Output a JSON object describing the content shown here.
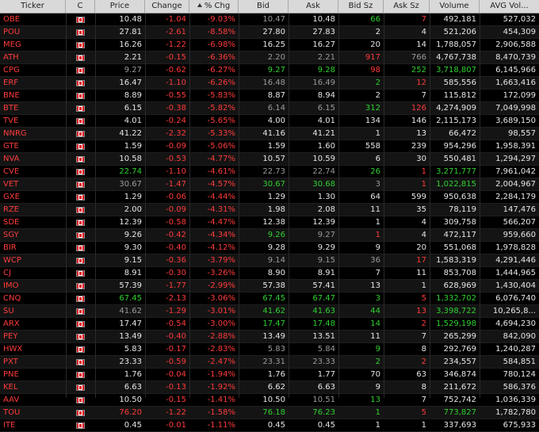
{
  "columns": [
    {
      "key": "ticker",
      "label": "Ticker"
    },
    {
      "key": "c",
      "label": "C"
    },
    {
      "key": "price",
      "label": "Price"
    },
    {
      "key": "change",
      "label": "Change"
    },
    {
      "key": "pct",
      "label": "% Chg"
    },
    {
      "key": "bid",
      "label": "Bid"
    },
    {
      "key": "ask",
      "label": "Ask"
    },
    {
      "key": "bidsz",
      "label": "Bid Sz"
    },
    {
      "key": "asksz",
      "label": "Ask Sz"
    },
    {
      "key": "volume",
      "label": "Volume"
    },
    {
      "key": "avgvol",
      "label": "AVG Vol..."
    }
  ],
  "colors": {
    "red": "#ff3b3b",
    "green": "#2fd12f",
    "grey": "#9a9a9a",
    "white": "#dcdcdc"
  },
  "rows": [
    {
      "ticker": "OBE",
      "price": "10.48",
      "change": "-1.04",
      "pct": "-9.03%",
      "bid": "10.47",
      "ask": "10.48",
      "bidsz": "66",
      "asksz": "7",
      "volume": "492,181",
      "avgvol": "527,032",
      "pc": "white",
      "bc": "grey",
      "ac": "white",
      "bsc": "green",
      "asc": "red",
      "vc": "white"
    },
    {
      "ticker": "POU",
      "price": "27.81",
      "change": "-2.61",
      "pct": "-8.58%",
      "bid": "27.80",
      "ask": "27.83",
      "bidsz": "2",
      "asksz": "4",
      "volume": "521,206",
      "avgvol": "454,309",
      "pc": "white",
      "bc": "white",
      "ac": "white",
      "bsc": "white",
      "asc": "white",
      "vc": "white"
    },
    {
      "ticker": "MEG",
      "price": "16.26",
      "change": "-1.22",
      "pct": "-6.98%",
      "bid": "16.25",
      "ask": "16.27",
      "bidsz": "20",
      "asksz": "14",
      "volume": "1,788,057",
      "avgvol": "2,906,588",
      "pc": "white",
      "bc": "white",
      "ac": "white",
      "bsc": "white",
      "asc": "white",
      "vc": "white"
    },
    {
      "ticker": "ATH",
      "price": "2.21",
      "change": "-0.15",
      "pct": "-6.36%",
      "bid": "2.20",
      "ask": "2.21",
      "bidsz": "917",
      "asksz": "766",
      "volume": "4,767,738",
      "avgvol": "8,470,739",
      "pc": "white",
      "bc": "grey",
      "ac": "grey",
      "bsc": "red",
      "asc": "grey",
      "vc": "white"
    },
    {
      "ticker": "CPG",
      "price": "9.27",
      "change": "-0.62",
      "pct": "-6.27%",
      "bid": "9.27",
      "ask": "9.28",
      "bidsz": "98",
      "asksz": "252",
      "volume": "3,718,807",
      "avgvol": "6,145,966",
      "pc": "grey",
      "bc": "green",
      "ac": "green",
      "bsc": "red",
      "asc": "green",
      "vc": "green"
    },
    {
      "ticker": "ERF",
      "price": "16.47",
      "change": "-1.10",
      "pct": "-6.26%",
      "bid": "16.48",
      "ask": "16.49",
      "bidsz": "2",
      "asksz": "12",
      "volume": "585,556",
      "avgvol": "1,663,416",
      "pc": "white",
      "bc": "grey",
      "ac": "grey",
      "bsc": "green",
      "asc": "red",
      "vc": "white"
    },
    {
      "ticker": "BNE",
      "price": "8.89",
      "change": "-0.55",
      "pct": "-5.83%",
      "bid": "8.87",
      "ask": "8.94",
      "bidsz": "2",
      "asksz": "7",
      "volume": "115,812",
      "avgvol": "172,099",
      "pc": "white",
      "bc": "white",
      "ac": "white",
      "bsc": "white",
      "asc": "white",
      "vc": "white"
    },
    {
      "ticker": "BTE",
      "price": "6.15",
      "change": "-0.38",
      "pct": "-5.82%",
      "bid": "6.14",
      "ask": "6.15",
      "bidsz": "312",
      "asksz": "126",
      "volume": "4,274,909",
      "avgvol": "7,049,998",
      "pc": "white",
      "bc": "grey",
      "ac": "grey",
      "bsc": "green",
      "asc": "red",
      "vc": "white"
    },
    {
      "ticker": "TVE",
      "price": "4.01",
      "change": "-0.24",
      "pct": "-5.65%",
      "bid": "4.00",
      "ask": "4.01",
      "bidsz": "134",
      "asksz": "146",
      "volume": "2,115,173",
      "avgvol": "3,689,150",
      "pc": "white",
      "bc": "white",
      "ac": "white",
      "bsc": "white",
      "asc": "white",
      "vc": "white"
    },
    {
      "ticker": "NNRG",
      "price": "41.22",
      "change": "-2.32",
      "pct": "-5.33%",
      "bid": "41.16",
      "ask": "41.21",
      "bidsz": "1",
      "asksz": "13",
      "volume": "66,472",
      "avgvol": "98,557",
      "pc": "white",
      "bc": "white",
      "ac": "white",
      "bsc": "white",
      "asc": "white",
      "vc": "white"
    },
    {
      "ticker": "GTE",
      "price": "1.59",
      "change": "-0.09",
      "pct": "-5.06%",
      "bid": "1.59",
      "ask": "1.60",
      "bidsz": "558",
      "asksz": "239",
      "volume": "954,296",
      "avgvol": "1,958,391",
      "pc": "white",
      "bc": "white",
      "ac": "white",
      "bsc": "white",
      "asc": "white",
      "vc": "white"
    },
    {
      "ticker": "NVA",
      "price": "10.58",
      "change": "-0.53",
      "pct": "-4.77%",
      "bid": "10.57",
      "ask": "10.59",
      "bidsz": "6",
      "asksz": "30",
      "volume": "550,481",
      "avgvol": "1,294,297",
      "pc": "white",
      "bc": "white",
      "ac": "white",
      "bsc": "white",
      "asc": "white",
      "vc": "white"
    },
    {
      "ticker": "CVE",
      "price": "22.74",
      "change": "-1.10",
      "pct": "-4.61%",
      "bid": "22.73",
      "ask": "22.74",
      "bidsz": "26",
      "asksz": "1",
      "volume": "3,271,777",
      "avgvol": "7,961,042",
      "pc": "green",
      "bc": "grey",
      "ac": "grey",
      "bsc": "green",
      "asc": "red",
      "vc": "green"
    },
    {
      "ticker": "VET",
      "price": "30.67",
      "change": "-1.47",
      "pct": "-4.57%",
      "bid": "30.67",
      "ask": "30.68",
      "bidsz": "3",
      "asksz": "1",
      "volume": "1,022,815",
      "avgvol": "2,004,967",
      "pc": "grey",
      "bc": "green",
      "ac": "green",
      "bsc": "grey",
      "asc": "red",
      "vc": "green"
    },
    {
      "ticker": "GXE",
      "price": "1.29",
      "change": "-0.06",
      "pct": "-4.44%",
      "bid": "1.29",
      "ask": "1.30",
      "bidsz": "64",
      "asksz": "599",
      "volume": "950,638",
      "avgvol": "2,284,179",
      "pc": "white",
      "bc": "white",
      "ac": "white",
      "bsc": "white",
      "asc": "white",
      "vc": "white"
    },
    {
      "ticker": "RZE",
      "price": "2.00",
      "change": "-0.09",
      "pct": "-4.31%",
      "bid": "1.98",
      "ask": "2.08",
      "bidsz": "11",
      "asksz": "35",
      "volume": "78,119",
      "avgvol": "147,476",
      "pc": "white",
      "bc": "white",
      "ac": "white",
      "bsc": "white",
      "asc": "white",
      "vc": "white"
    },
    {
      "ticker": "SDE",
      "price": "12.39",
      "change": "-0.58",
      "pct": "-4.47%",
      "bid": "12.38",
      "ask": "12.39",
      "bidsz": "1",
      "asksz": "4",
      "volume": "309,758",
      "avgvol": "566,207",
      "pc": "white",
      "bc": "white",
      "ac": "white",
      "bsc": "white",
      "asc": "white",
      "vc": "white"
    },
    {
      "ticker": "SGY",
      "price": "9.26",
      "change": "-0.42",
      "pct": "-4.34%",
      "bid": "9.26",
      "ask": "9.27",
      "bidsz": "1",
      "asksz": "4",
      "volume": "472,117",
      "avgvol": "959,660",
      "pc": "white",
      "bc": "green",
      "ac": "grey",
      "bsc": "red",
      "asc": "white",
      "vc": "white"
    },
    {
      "ticker": "BIR",
      "price": "9.30",
      "change": "-0.40",
      "pct": "-4.12%",
      "bid": "9.28",
      "ask": "9.29",
      "bidsz": "9",
      "asksz": "20",
      "volume": "551,068",
      "avgvol": "1,978,828",
      "pc": "white",
      "bc": "white",
      "ac": "white",
      "bsc": "white",
      "asc": "white",
      "vc": "white"
    },
    {
      "ticker": "WCP",
      "price": "9.15",
      "change": "-0.36",
      "pct": "-3.79%",
      "bid": "9.14",
      "ask": "9.15",
      "bidsz": "36",
      "asksz": "17",
      "volume": "1,583,319",
      "avgvol": "4,291,446",
      "pc": "white",
      "bc": "grey",
      "ac": "grey",
      "bsc": "grey",
      "asc": "red",
      "vc": "white"
    },
    {
      "ticker": "CJ",
      "price": "8.91",
      "change": "-0.30",
      "pct": "-3.26%",
      "bid": "8.90",
      "ask": "8.91",
      "bidsz": "7",
      "asksz": "11",
      "volume": "853,708",
      "avgvol": "1,444,965",
      "pc": "white",
      "bc": "white",
      "ac": "white",
      "bsc": "white",
      "asc": "white",
      "vc": "white"
    },
    {
      "ticker": "IMO",
      "price": "57.39",
      "change": "-1.77",
      "pct": "-2.99%",
      "bid": "57.38",
      "ask": "57.41",
      "bidsz": "13",
      "asksz": "1",
      "volume": "628,969",
      "avgvol": "1,430,404",
      "pc": "white",
      "bc": "white",
      "ac": "white",
      "bsc": "white",
      "asc": "white",
      "vc": "white"
    },
    {
      "ticker": "CNQ",
      "price": "67.45",
      "change": "-2.13",
      "pct": "-3.06%",
      "bid": "67.45",
      "ask": "67.47",
      "bidsz": "3",
      "asksz": "5",
      "volume": "1,332,702",
      "avgvol": "6,076,740",
      "pc": "green",
      "bc": "green",
      "ac": "green",
      "bsc": "green",
      "asc": "red",
      "vc": "green"
    },
    {
      "ticker": "SU",
      "price": "41.62",
      "change": "-1.29",
      "pct": "-3.01%",
      "bid": "41.62",
      "ask": "41.63",
      "bidsz": "44",
      "asksz": "13",
      "volume": "3,398,722",
      "avgvol": "10,265,8...",
      "pc": "grey",
      "bc": "green",
      "ac": "green",
      "bsc": "green",
      "asc": "red",
      "vc": "green"
    },
    {
      "ticker": "ARX",
      "price": "17.47",
      "change": "-0.54",
      "pct": "-3.00%",
      "bid": "17.47",
      "ask": "17.48",
      "bidsz": "14",
      "asksz": "2",
      "volume": "1,529,198",
      "avgvol": "4,694,230",
      "pc": "white",
      "bc": "green",
      "ac": "green",
      "bsc": "green",
      "asc": "red",
      "vc": "green"
    },
    {
      "ticker": "PEY",
      "price": "13.49",
      "change": "-0.40",
      "pct": "-2.88%",
      "bid": "13.49",
      "ask": "13.51",
      "bidsz": "11",
      "asksz": "7",
      "volume": "265,299",
      "avgvol": "842,090",
      "pc": "white",
      "bc": "white",
      "ac": "white",
      "bsc": "white",
      "asc": "white",
      "vc": "white"
    },
    {
      "ticker": "HWX",
      "price": "5.83",
      "change": "-0.17",
      "pct": "-2.83%",
      "bid": "5.83",
      "ask": "5.84",
      "bidsz": "9",
      "asksz": "8",
      "volume": "292,769",
      "avgvol": "1,240,287",
      "pc": "white",
      "bc": "grey",
      "ac": "grey",
      "bsc": "green",
      "asc": "white",
      "vc": "white"
    },
    {
      "ticker": "PXT",
      "price": "23.33",
      "change": "-0.59",
      "pct": "-2.47%",
      "bid": "23.31",
      "ask": "23.33",
      "bidsz": "2",
      "asksz": "2",
      "volume": "234,557",
      "avgvol": "584,851",
      "pc": "white",
      "bc": "grey",
      "ac": "grey",
      "bsc": "green",
      "asc": "red",
      "vc": "white"
    },
    {
      "ticker": "PNE",
      "price": "1.76",
      "change": "-0.04",
      "pct": "-1.94%",
      "bid": "1.76",
      "ask": "1.77",
      "bidsz": "70",
      "asksz": "63",
      "volume": "346,874",
      "avgvol": "780,124",
      "pc": "white",
      "bc": "white",
      "ac": "white",
      "bsc": "white",
      "asc": "white",
      "vc": "white"
    },
    {
      "ticker": "KEL",
      "price": "6.63",
      "change": "-0.13",
      "pct": "-1.92%",
      "bid": "6.62",
      "ask": "6.63",
      "bidsz": "9",
      "asksz": "8",
      "volume": "211,672",
      "avgvol": "586,376",
      "pc": "white",
      "bc": "white",
      "ac": "white",
      "bsc": "white",
      "asc": "white",
      "vc": "white"
    },
    {
      "ticker": "AAV",
      "price": "10.50",
      "change": "-0.15",
      "pct": "-1.41%",
      "bid": "10.50",
      "ask": "10.51",
      "bidsz": "13",
      "asksz": "7",
      "volume": "752,742",
      "avgvol": "1,036,339",
      "pc": "white",
      "bc": "white",
      "ac": "grey",
      "bsc": "green",
      "asc": "white",
      "vc": "white"
    },
    {
      "ticker": "TOU",
      "price": "76.20",
      "change": "-1.22",
      "pct": "-1.58%",
      "bid": "76.18",
      "ask": "76.23",
      "bidsz": "1",
      "asksz": "5",
      "volume": "773,827",
      "avgvol": "1,782,780",
      "pc": "red",
      "bc": "green",
      "ac": "green",
      "bsc": "green",
      "asc": "red",
      "vc": "green"
    },
    {
      "ticker": "ITE",
      "price": "0.45",
      "change": "-0.01",
      "pct": "-1.11%",
      "bid": "0.45",
      "ask": "0.45",
      "bidsz": "1",
      "asksz": "1",
      "volume": "337,693",
      "avgvol": "675,933",
      "pc": "white",
      "bc": "white",
      "ac": "white",
      "bsc": "white",
      "asc": "white",
      "vc": "white"
    }
  ]
}
